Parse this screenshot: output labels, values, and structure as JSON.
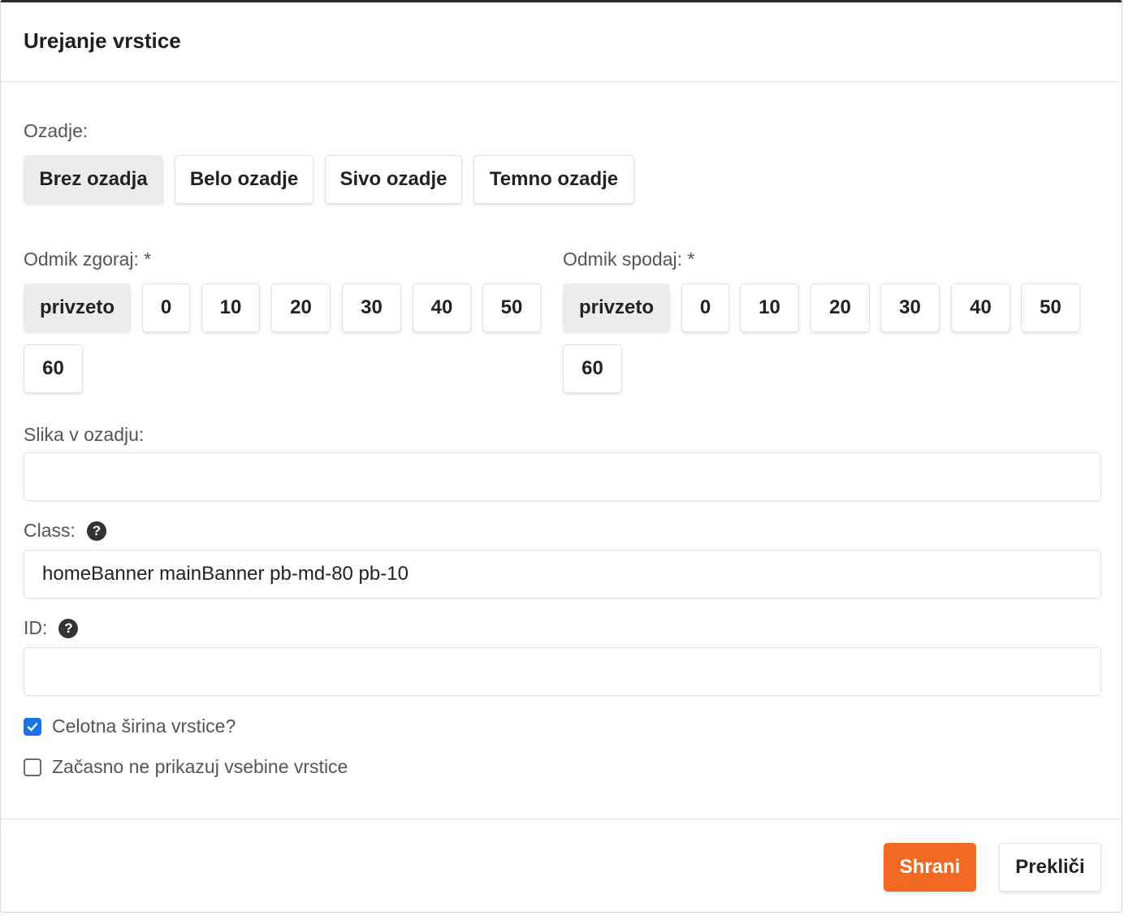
{
  "dialog": {
    "title": "Urejanje vrstice"
  },
  "background": {
    "label": "Ozadje:",
    "options": [
      "Brez ozadja",
      "Belo ozadje",
      "Sivo ozadje",
      "Temno ozadje"
    ],
    "selected": "Brez ozadja"
  },
  "spacing_top": {
    "label": "Odmik zgoraj: *",
    "options": [
      "privzeto",
      "0",
      "10",
      "20",
      "30",
      "40",
      "50",
      "60"
    ],
    "selected": "privzeto"
  },
  "spacing_bottom": {
    "label": "Odmik spodaj: *",
    "options": [
      "privzeto",
      "0",
      "10",
      "20",
      "30",
      "40",
      "50",
      "60"
    ],
    "selected": "privzeto"
  },
  "bg_image": {
    "label": "Slika v ozadju:",
    "value": ""
  },
  "css_class": {
    "label": "Class:",
    "value": "homeBanner mainBanner pb-md-80 pb-10",
    "help_icon": "question-circle-icon"
  },
  "element_id": {
    "label": "ID:",
    "value": "",
    "help_icon": "question-circle-icon"
  },
  "checkboxes": {
    "full_width": {
      "label": "Celotna širina vrstice?",
      "checked": true
    },
    "hide_content": {
      "label": "Začasno ne prikazuj vsebine vrstice",
      "checked": false
    }
  },
  "footer": {
    "save_label": "Shrani",
    "cancel_label": "Prekliči"
  },
  "colors": {
    "primary": "#f26a21",
    "checkbox_checked": "#1a73e8",
    "active_option_bg": "#ececec"
  }
}
